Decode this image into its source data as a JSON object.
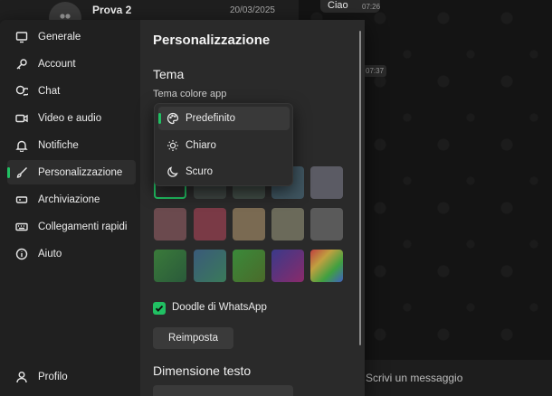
{
  "background": {
    "chat_name": "Prova 2",
    "chat_date": "20/03/2025",
    "bubble_text": "Ciao",
    "bubble_time": "07:26",
    "second_time": "07:37",
    "composer_placeholder": "Scrivi un messaggio"
  },
  "nav": {
    "items": [
      {
        "label": "Generale",
        "icon": "computer-icon"
      },
      {
        "label": "Account",
        "icon": "key-icon"
      },
      {
        "label": "Chat",
        "icon": "chat-bubbles-icon"
      },
      {
        "label": "Video e audio",
        "icon": "video-camera-icon"
      },
      {
        "label": "Notifiche",
        "icon": "bell-icon"
      },
      {
        "label": "Personalizzazione",
        "icon": "brush-icon",
        "active": true
      },
      {
        "label": "Archiviazione",
        "icon": "storage-icon"
      },
      {
        "label": "Collegamenti rapidi",
        "icon": "keyboard-icon"
      },
      {
        "label": "Aiuto",
        "icon": "info-icon"
      }
    ],
    "profile_label": "Profilo"
  },
  "panel": {
    "title": "Personalizzazione",
    "theme_section": "Tema",
    "theme_color_label": "Tema colore app",
    "doodle_label": "Doodle di WhatsApp",
    "doodle_checked": true,
    "reset_button": "Reimposta",
    "text_size_section": "Dimensione testo"
  },
  "dropdown": {
    "options": [
      {
        "label": "Predefinito",
        "icon": "palette-icon",
        "selected": true
      },
      {
        "label": "Chiaro",
        "icon": "sun-icon"
      },
      {
        "label": "Scuro",
        "icon": "moon-icon"
      }
    ]
  },
  "colors": {
    "accent": "#21c063",
    "swatches_row1": [
      "#2b2b2b",
      "#3c4340",
      "#3f4a44",
      "#3f5560",
      "#5b5b64"
    ],
    "swatches_row2": [
      "#6b4a4e",
      "#7a3a46",
      "#7a6a52",
      "#6b6a5a",
      "#5a5a5a"
    ],
    "swatches_row3": [
      "#2f6a3a",
      "#3a6a6a",
      "#3a7a3a",
      "#6a2a6a",
      "gradient-rainbow"
    ]
  }
}
